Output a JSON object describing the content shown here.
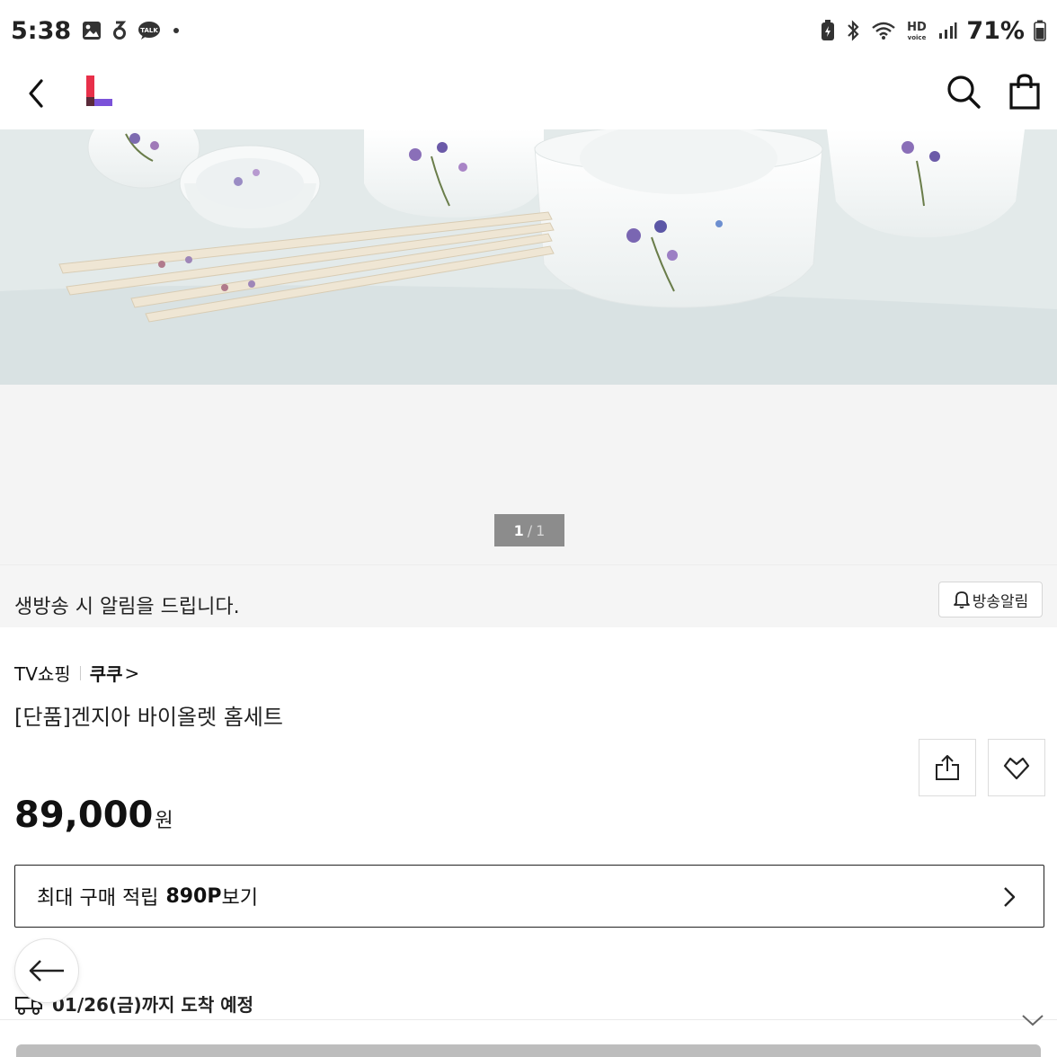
{
  "status_bar": {
    "time": "5:38",
    "talk_label": "TALK",
    "hd_label": "HD",
    "voice_label": "voice",
    "battery": "71%"
  },
  "header": {
    "back_icon": "chevron-left-icon",
    "logo_colors": [
      "#e8304a",
      "#7b52d9",
      "#5b2a3a"
    ],
    "search_icon": "search-icon",
    "bag_icon": "shopping-bag-icon"
  },
  "hero": {
    "image_index": "1",
    "separator": "/",
    "image_total": "1"
  },
  "alert": {
    "text": "생방송 시 알림을 드립니다.",
    "button_label": "방송알림"
  },
  "breadcrumb": {
    "channel": "TV쇼핑",
    "brand": "쿠쿠",
    "chevron": ">"
  },
  "product": {
    "title": "[단품]겐지아 바이올렛 홈세트",
    "price": "89,000",
    "price_unit": "원"
  },
  "points": {
    "prefix": "최대 구매 적립",
    "value": "890P",
    "suffix": "보기"
  },
  "delivery": {
    "text": "01/26(금)까지 도착 예정"
  },
  "colors": {
    "accent": "#7b52d9",
    "indicator_bg": "#8c8c8c",
    "text": "#111111"
  }
}
